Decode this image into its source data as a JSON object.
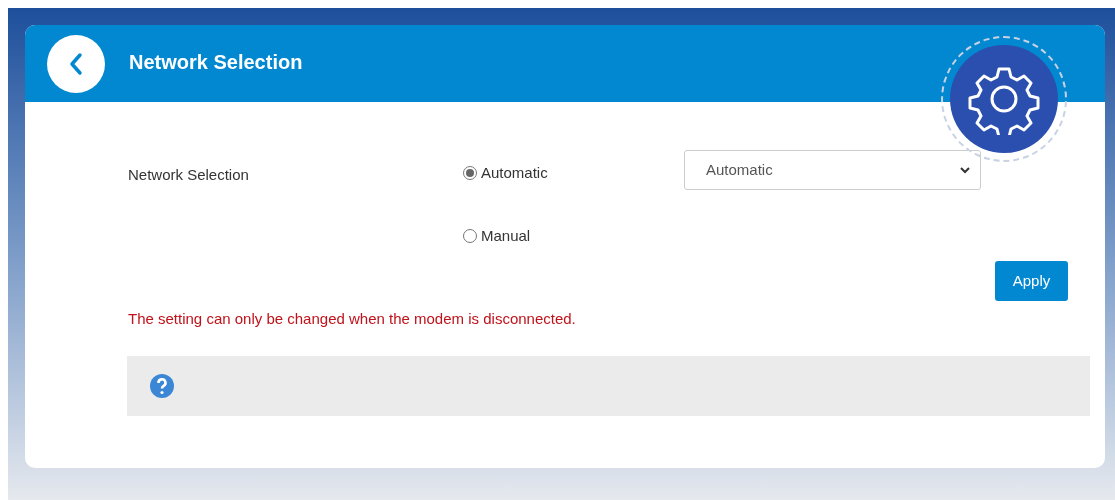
{
  "header": {
    "title": "Network Selection"
  },
  "form": {
    "label": "Network Selection",
    "options": [
      {
        "label": "Automatic",
        "selected": true
      },
      {
        "label": "Manual",
        "selected": false
      }
    ],
    "select": {
      "value": "Automatic"
    }
  },
  "apply_button": "Apply",
  "warning": "The setting can only be changed when the modem is disconnected."
}
